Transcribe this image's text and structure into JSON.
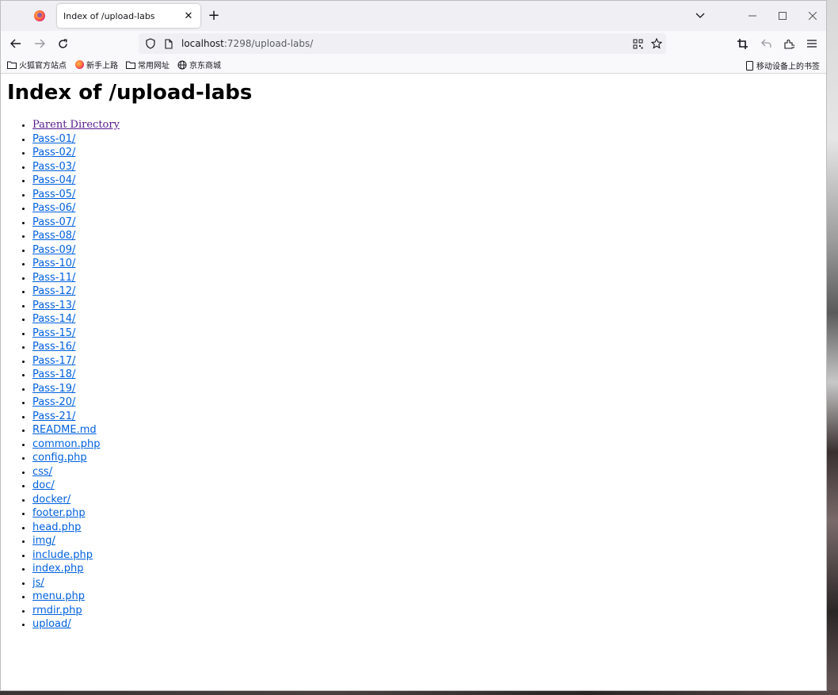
{
  "browser": {
    "tab_title": "Index of /upload-labs",
    "tab_close": "✕",
    "new_tab": "+",
    "url_host": "localhost",
    "url_rest": ":7298/upload-labs/"
  },
  "bookmarks": [
    {
      "label": "火狐官方站点",
      "icon": "folder-icon"
    },
    {
      "label": "新手上路",
      "icon": "firefox-icon"
    },
    {
      "label": "常用网址",
      "icon": "folder-icon"
    },
    {
      "label": "京东商城",
      "icon": "globe-icon"
    }
  ],
  "mobile_bookmarks": "移动设备上的书签",
  "page": {
    "heading": "Index of /upload-labs",
    "parent": "Parent Directory",
    "entries": [
      "Pass-01/",
      "Pass-02/",
      "Pass-03/",
      "Pass-04/",
      "Pass-05/",
      "Pass-06/",
      "Pass-07/",
      "Pass-08/",
      "Pass-09/",
      "Pass-10/",
      "Pass-11/",
      "Pass-12/",
      "Pass-13/",
      "Pass-14/",
      "Pass-15/",
      "Pass-16/",
      "Pass-17/",
      "Pass-18/",
      "Pass-19/",
      "Pass-20/",
      "Pass-21/",
      "README.md",
      "common.php",
      "config.php",
      "css/",
      "doc/",
      "docker/",
      "footer.php",
      "head.php",
      "img/",
      "include.php",
      "index.php",
      "js/",
      "menu.php",
      "rmdir.php",
      "upload/"
    ]
  },
  "colors": {
    "link": "#0060df",
    "visited_link": "#551a8b"
  }
}
